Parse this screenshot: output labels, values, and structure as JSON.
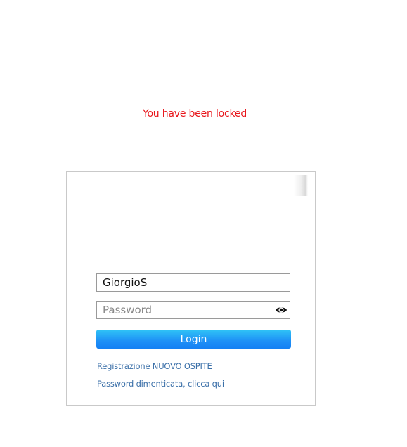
{
  "message": {
    "locked_text": "You have been locked"
  },
  "login_form": {
    "username_value": "GiorgioS",
    "password_placeholder": "Password",
    "login_label": "Login",
    "register_link": "Registrazione NUOVO OSPITE",
    "forgot_link": "Password dimenticata, clicca qui"
  },
  "icons": {
    "password_toggle": "eye-icon"
  },
  "colors": {
    "error_text": "#e8161b",
    "button_top": "#30c4f6",
    "button_bottom": "#1580f4",
    "link_text": "#3a6fa8",
    "box_border": "#c9c9c9"
  }
}
